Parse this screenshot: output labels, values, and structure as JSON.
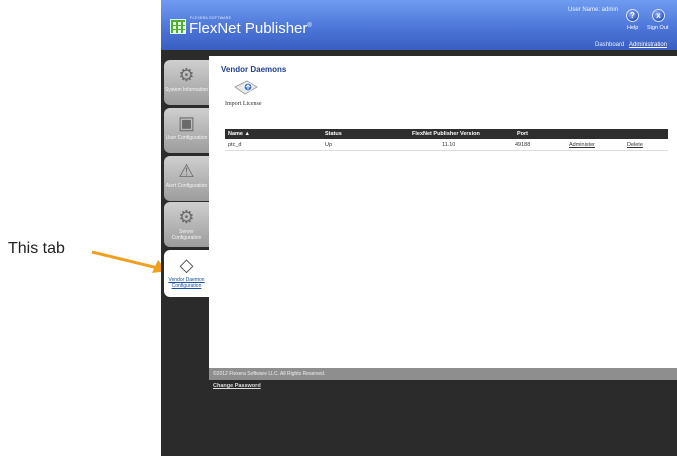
{
  "annotation": {
    "text": "This tab",
    "arrow_color": "#f0a020"
  },
  "header": {
    "brand_small": "FLEXERA SOFTWARE",
    "brand": "FlexNet Publisher",
    "brand_mark": "®",
    "user_name": "User Name: admin",
    "help_label": "Help",
    "help_icon": "?",
    "signout_label": "Sign Out",
    "signout_icon": "x",
    "nav": {
      "dashboard": "Dashboard",
      "administration": "Administration"
    }
  },
  "sidebar": {
    "items": [
      {
        "label": "System Information",
        "icon": "gears-icon"
      },
      {
        "label": "User Configuration",
        "icon": "user-card-icon"
      },
      {
        "label": "Alert Configuration",
        "icon": "warning-icon"
      },
      {
        "label": "Server Configuration",
        "icon": "gears-icon"
      },
      {
        "label": "Vendor Daemon Configuration",
        "icon": "vendor-daemon-icon",
        "active": true
      }
    ]
  },
  "main": {
    "title": "Vendor Daemons",
    "import_label": "Import License",
    "table": {
      "headers": [
        "Name ▲",
        "Status",
        "FlexNet Publisher Version",
        "Port"
      ],
      "rows": [
        {
          "name": "ptc_d",
          "status": "Up",
          "version": "11.10",
          "port": "49188",
          "administer": "Administer",
          "delete": "Delete"
        }
      ]
    }
  },
  "footer": {
    "copyright": "©2012 Flexera Software LLC. All Rights Reserved.",
    "change_password": "Change Password"
  },
  "colors": {
    "header_blue": "#4a73d6",
    "title_blue": "#1e3f8f",
    "frame_dark": "#2b2b2b"
  }
}
